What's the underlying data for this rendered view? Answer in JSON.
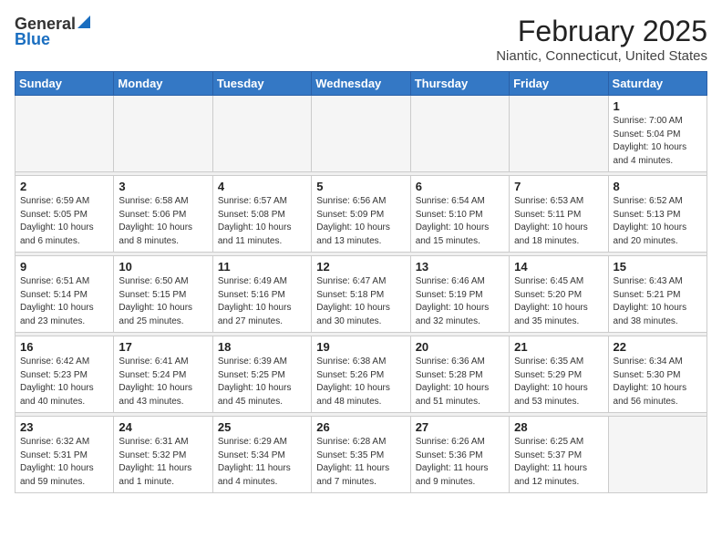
{
  "header": {
    "logo_general": "General",
    "logo_blue": "Blue",
    "month_year": "February 2025",
    "location": "Niantic, Connecticut, United States"
  },
  "weekdays": [
    "Sunday",
    "Monday",
    "Tuesday",
    "Wednesday",
    "Thursday",
    "Friday",
    "Saturday"
  ],
  "weeks": [
    [
      {
        "day": "",
        "info": ""
      },
      {
        "day": "",
        "info": ""
      },
      {
        "day": "",
        "info": ""
      },
      {
        "day": "",
        "info": ""
      },
      {
        "day": "",
        "info": ""
      },
      {
        "day": "",
        "info": ""
      },
      {
        "day": "1",
        "info": "Sunrise: 7:00 AM\nSunset: 5:04 PM\nDaylight: 10 hours\nand 4 minutes."
      }
    ],
    [
      {
        "day": "2",
        "info": "Sunrise: 6:59 AM\nSunset: 5:05 PM\nDaylight: 10 hours\nand 6 minutes."
      },
      {
        "day": "3",
        "info": "Sunrise: 6:58 AM\nSunset: 5:06 PM\nDaylight: 10 hours\nand 8 minutes."
      },
      {
        "day": "4",
        "info": "Sunrise: 6:57 AM\nSunset: 5:08 PM\nDaylight: 10 hours\nand 11 minutes."
      },
      {
        "day": "5",
        "info": "Sunrise: 6:56 AM\nSunset: 5:09 PM\nDaylight: 10 hours\nand 13 minutes."
      },
      {
        "day": "6",
        "info": "Sunrise: 6:54 AM\nSunset: 5:10 PM\nDaylight: 10 hours\nand 15 minutes."
      },
      {
        "day": "7",
        "info": "Sunrise: 6:53 AM\nSunset: 5:11 PM\nDaylight: 10 hours\nand 18 minutes."
      },
      {
        "day": "8",
        "info": "Sunrise: 6:52 AM\nSunset: 5:13 PM\nDaylight: 10 hours\nand 20 minutes."
      }
    ],
    [
      {
        "day": "9",
        "info": "Sunrise: 6:51 AM\nSunset: 5:14 PM\nDaylight: 10 hours\nand 23 minutes."
      },
      {
        "day": "10",
        "info": "Sunrise: 6:50 AM\nSunset: 5:15 PM\nDaylight: 10 hours\nand 25 minutes."
      },
      {
        "day": "11",
        "info": "Sunrise: 6:49 AM\nSunset: 5:16 PM\nDaylight: 10 hours\nand 27 minutes."
      },
      {
        "day": "12",
        "info": "Sunrise: 6:47 AM\nSunset: 5:18 PM\nDaylight: 10 hours\nand 30 minutes."
      },
      {
        "day": "13",
        "info": "Sunrise: 6:46 AM\nSunset: 5:19 PM\nDaylight: 10 hours\nand 32 minutes."
      },
      {
        "day": "14",
        "info": "Sunrise: 6:45 AM\nSunset: 5:20 PM\nDaylight: 10 hours\nand 35 minutes."
      },
      {
        "day": "15",
        "info": "Sunrise: 6:43 AM\nSunset: 5:21 PM\nDaylight: 10 hours\nand 38 minutes."
      }
    ],
    [
      {
        "day": "16",
        "info": "Sunrise: 6:42 AM\nSunset: 5:23 PM\nDaylight: 10 hours\nand 40 minutes."
      },
      {
        "day": "17",
        "info": "Sunrise: 6:41 AM\nSunset: 5:24 PM\nDaylight: 10 hours\nand 43 minutes."
      },
      {
        "day": "18",
        "info": "Sunrise: 6:39 AM\nSunset: 5:25 PM\nDaylight: 10 hours\nand 45 minutes."
      },
      {
        "day": "19",
        "info": "Sunrise: 6:38 AM\nSunset: 5:26 PM\nDaylight: 10 hours\nand 48 minutes."
      },
      {
        "day": "20",
        "info": "Sunrise: 6:36 AM\nSunset: 5:28 PM\nDaylight: 10 hours\nand 51 minutes."
      },
      {
        "day": "21",
        "info": "Sunrise: 6:35 AM\nSunset: 5:29 PM\nDaylight: 10 hours\nand 53 minutes."
      },
      {
        "day": "22",
        "info": "Sunrise: 6:34 AM\nSunset: 5:30 PM\nDaylight: 10 hours\nand 56 minutes."
      }
    ],
    [
      {
        "day": "23",
        "info": "Sunrise: 6:32 AM\nSunset: 5:31 PM\nDaylight: 10 hours\nand 59 minutes."
      },
      {
        "day": "24",
        "info": "Sunrise: 6:31 AM\nSunset: 5:32 PM\nDaylight: 11 hours\nand 1 minute."
      },
      {
        "day": "25",
        "info": "Sunrise: 6:29 AM\nSunset: 5:34 PM\nDaylight: 11 hours\nand 4 minutes."
      },
      {
        "day": "26",
        "info": "Sunrise: 6:28 AM\nSunset: 5:35 PM\nDaylight: 11 hours\nand 7 minutes."
      },
      {
        "day": "27",
        "info": "Sunrise: 6:26 AM\nSunset: 5:36 PM\nDaylight: 11 hours\nand 9 minutes."
      },
      {
        "day": "28",
        "info": "Sunrise: 6:25 AM\nSunset: 5:37 PM\nDaylight: 11 hours\nand 12 minutes."
      },
      {
        "day": "",
        "info": ""
      }
    ]
  ]
}
